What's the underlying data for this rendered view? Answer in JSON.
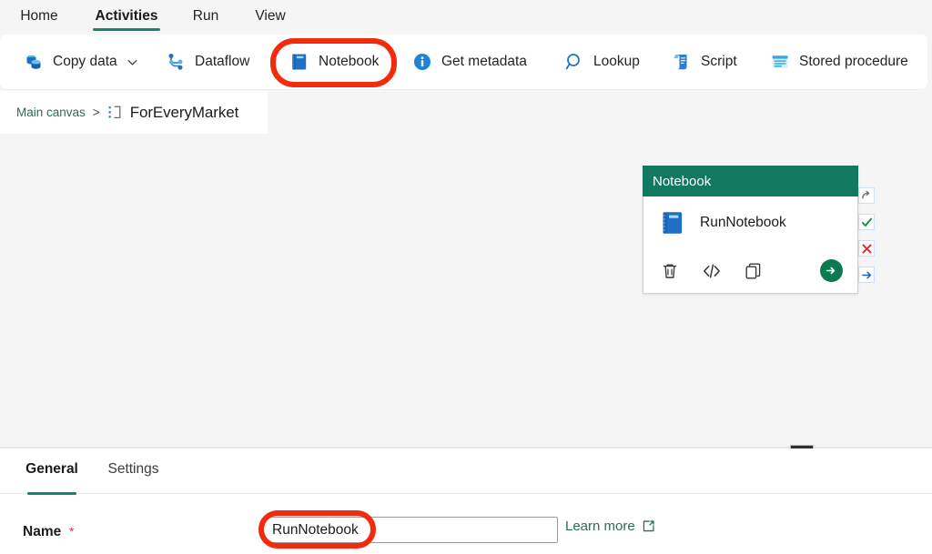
{
  "ribbon": {
    "tabs": [
      {
        "label": "Home",
        "active": false
      },
      {
        "label": "Activities",
        "active": true
      },
      {
        "label": "Run",
        "active": false
      },
      {
        "label": "View",
        "active": false
      }
    ],
    "active_underline_color": "#17836d"
  },
  "toolbar": {
    "items": [
      {
        "label": "Copy data",
        "icon": "copy-data-icon",
        "has_chevron": true
      },
      {
        "label": "Dataflow",
        "icon": "dataflow-icon",
        "has_chevron": false
      },
      {
        "label": "Notebook",
        "icon": "notebook-icon",
        "has_chevron": false
      },
      {
        "label": "Get metadata",
        "icon": "info-circle-icon",
        "has_chevron": false
      },
      {
        "label": "Lookup",
        "icon": "magnifier-icon",
        "has_chevron": false
      },
      {
        "label": "Script",
        "icon": "script-scroll-icon",
        "has_chevron": false
      },
      {
        "label": "Stored procedure",
        "icon": "stored-procedure-icon",
        "has_chevron": false
      }
    ]
  },
  "breadcrumb": {
    "root_label": "Main canvas",
    "separator": ">",
    "current_label": "ForEveryMarket",
    "current_icon": "foreach-activity-icon"
  },
  "canvas": {
    "activity_card": {
      "header_title": "Notebook",
      "header_color": "#12785f",
      "activity_name": "RunNotebook",
      "activity_icon": "notebook-icon",
      "footer_buttons": [
        {
          "name": "delete-button",
          "icon": "trash-icon",
          "glyph": ""
        },
        {
          "name": "code-view-button",
          "icon": "code-icon",
          "glyph": "</>"
        },
        {
          "name": "duplicate-button",
          "icon": "copy-icon",
          "glyph": ""
        }
      ],
      "run_button": {
        "name": "run-activity-button",
        "icon": "arrow-right-circle-icon"
      },
      "connectors": [
        {
          "name": "on-skip-connector",
          "icon": "retry-arrow-icon",
          "color": "#707070"
        },
        {
          "name": "on-success-connector",
          "icon": "checkmark-icon",
          "color": "#1d8a3b"
        },
        {
          "name": "on-fail-connector",
          "icon": "cross-x-icon",
          "color": "#d13438"
        },
        {
          "name": "on-completion-connector",
          "icon": "arrow-right-icon",
          "color": "#1565c0"
        }
      ]
    },
    "background_color": "#f5f5f5"
  },
  "bottom_panel": {
    "tabs": [
      {
        "label": "General",
        "active": true
      },
      {
        "label": "Settings",
        "active": false
      }
    ],
    "name_field": {
      "label": "Name",
      "required_marker": "*",
      "value": "RunNotebook",
      "placeholder": ""
    },
    "learn_more": {
      "label": "Learn more",
      "icon": "external-link-icon"
    },
    "drag_handle": {
      "name": "panel-resize-handle"
    }
  },
  "annotations": {
    "color": "#f32a0c",
    "highlights": [
      {
        "name": "annotation-notebook-toolbar-button"
      },
      {
        "name": "annotation-name-field"
      }
    ]
  }
}
